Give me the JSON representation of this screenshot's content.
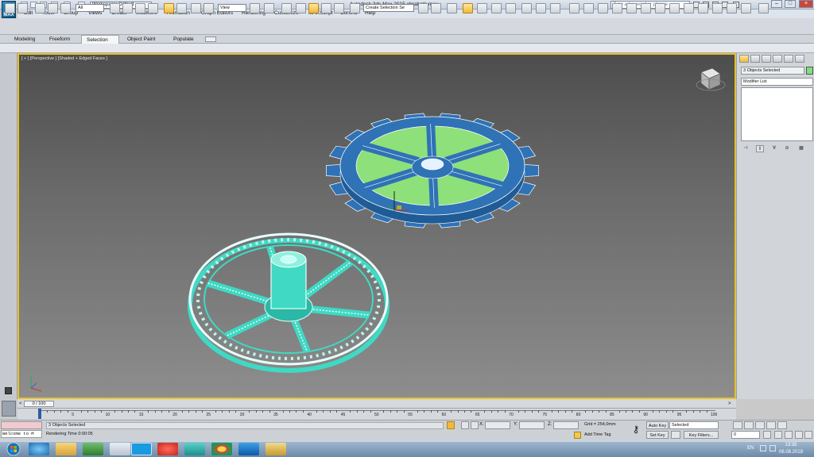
{
  "title_bar": {
    "workspace": "Workspace: Default",
    "window_title": "Autodesk 3ds Max 2015    obrabotk.max",
    "search_placeholder": "Type a keyword or phrase",
    "minimize": "–",
    "maximize": "□",
    "close": "×"
  },
  "menu": [
    "Edit",
    "Tools",
    "Group",
    "Views",
    "Create",
    "Modifiers",
    "Animation",
    "Graph Editors",
    "Rendering",
    "Customize",
    "MAXScript",
    "Corona",
    "Help"
  ],
  "main_toolbar": {
    "filter": "All",
    "ref_coord": "View",
    "selection_set": "Create Selection Se"
  },
  "ribbon": {
    "tabs": [
      "Modeling",
      "Freeform",
      "Selection",
      "Object Paint",
      "Populate"
    ],
    "active": "Selection"
  },
  "viewport": {
    "label": "[ + ] [Perspective ] [Shaded + Edged Faces ]"
  },
  "command_panel": {
    "object_name": "3 Objects Selected",
    "object_color": "#7fe07f",
    "modifier_list": "Modifier List"
  },
  "timeline": {
    "frame": "0 / 100",
    "ticks": [
      "0",
      "5",
      "10",
      "15",
      "20",
      "25",
      "30",
      "35",
      "40",
      "45",
      "50",
      "55",
      "60",
      "65",
      "70",
      "75",
      "80",
      "85",
      "90",
      "95",
      "100"
    ]
  },
  "status": {
    "maxscript": "Welcome to M",
    "selection": "3 Objects Selected",
    "render_time": "Rendering Time  0:00:05",
    "x_label": "X:",
    "y_label": "Y:",
    "z_label": "Z:",
    "grid": "Grid = 254,0mm",
    "add_time_tag": "Add Time Tag",
    "auto_key": "Auto Key",
    "set_key": "Set Key",
    "selected": "Selected",
    "key_filters": "Key Filters...",
    "frame_value": "0"
  },
  "taskbar": {
    "language": "EN",
    "time": "13:35",
    "date": "06.08.2018"
  },
  "colors": {
    "gear_blue": "#2f72b6",
    "gear_green": "#8ee07a",
    "wire_cyan": "#3fd9c4",
    "viewport_border": "#e8c02a"
  }
}
